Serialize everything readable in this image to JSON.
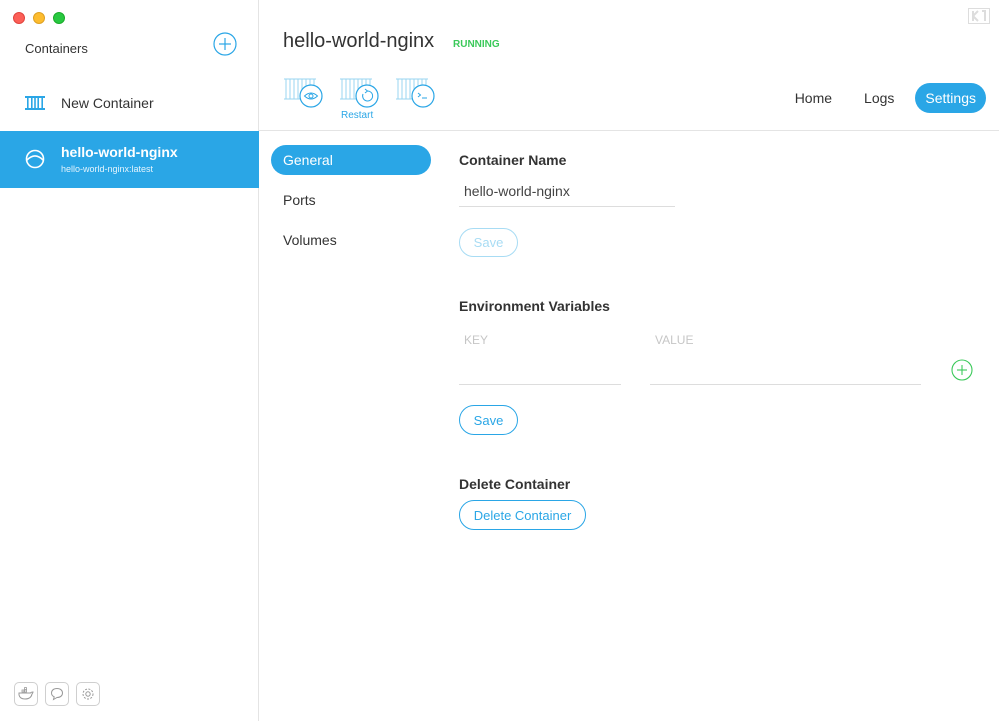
{
  "sidebar": {
    "title": "Containers",
    "new_container_label": "New Container",
    "active_container": {
      "name": "hello-world-nginx",
      "image": "hello-world-nginx:latest"
    }
  },
  "header": {
    "container_name": "hello-world-nginx",
    "status": "RUNNING",
    "restart_label": "Restart",
    "tabs": [
      {
        "label": "Home"
      },
      {
        "label": "Logs"
      },
      {
        "label": "Settings"
      }
    ]
  },
  "subnav": {
    "items": [
      {
        "label": "General"
      },
      {
        "label": "Ports"
      },
      {
        "label": "Volumes"
      }
    ]
  },
  "general": {
    "container_name_title": "Container Name",
    "container_name_value": "hello-world-nginx",
    "save_label": "Save",
    "env_title": "Environment Variables",
    "key_placeholder": "KEY",
    "value_placeholder": "VALUE",
    "env_save_label": "Save",
    "delete_title": "Delete Container",
    "delete_label": "Delete Container"
  },
  "colors": {
    "accent": "#2aa6e6",
    "running": "#3bc95a"
  }
}
